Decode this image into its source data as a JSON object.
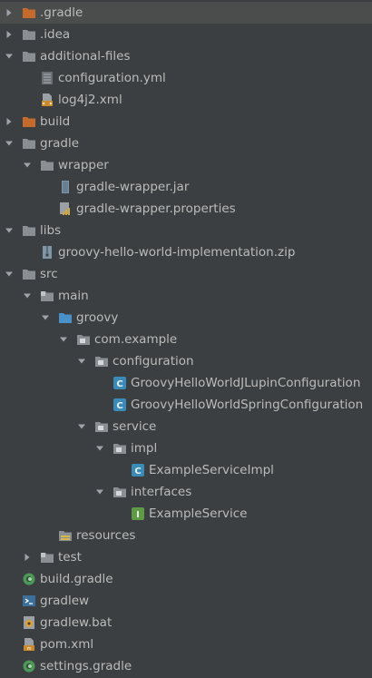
{
  "tree": {
    "items": [
      {
        "label": ".gradle",
        "icon": "folder-excluded-icon",
        "state": "collapsed",
        "selected": true
      },
      {
        "label": ".idea",
        "icon": "folder-icon",
        "state": "collapsed"
      },
      {
        "label": "additional-files",
        "icon": "folder-icon",
        "state": "expanded"
      },
      {
        "label": "configuration.yml",
        "icon": "yaml-file-icon",
        "state": "leaf"
      },
      {
        "label": "log4j2.xml",
        "icon": "xml-file-icon",
        "state": "leaf"
      },
      {
        "label": "build",
        "icon": "folder-excluded-icon",
        "state": "collapsed"
      },
      {
        "label": "gradle",
        "icon": "folder-icon",
        "state": "expanded"
      },
      {
        "label": "wrapper",
        "icon": "folder-icon",
        "state": "expanded"
      },
      {
        "label": "gradle-wrapper.jar",
        "icon": "jar-file-icon",
        "state": "leaf"
      },
      {
        "label": "gradle-wrapper.properties",
        "icon": "properties-file-icon",
        "state": "leaf"
      },
      {
        "label": "libs",
        "icon": "folder-icon",
        "state": "expanded"
      },
      {
        "label": "groovy-hello-world-implementation.zip",
        "icon": "archive-file-icon",
        "state": "leaf"
      },
      {
        "label": "src",
        "icon": "folder-icon",
        "state": "expanded"
      },
      {
        "label": "main",
        "icon": "module-folder-icon",
        "state": "expanded"
      },
      {
        "label": "groovy",
        "icon": "source-root-folder-icon",
        "state": "expanded"
      },
      {
        "label": "com.example",
        "icon": "package-icon",
        "state": "expanded"
      },
      {
        "label": "configuration",
        "icon": "package-icon",
        "state": "expanded"
      },
      {
        "label": "GroovyHelloWorldJLupinConfiguration",
        "icon": "groovy-class-icon",
        "state": "leaf"
      },
      {
        "label": "GroovyHelloWorldSpringConfiguration",
        "icon": "groovy-class-icon",
        "state": "leaf"
      },
      {
        "label": "service",
        "icon": "package-icon",
        "state": "expanded"
      },
      {
        "label": "impl",
        "icon": "package-icon",
        "state": "expanded"
      },
      {
        "label": "ExampleServiceImpl",
        "icon": "groovy-class-icon",
        "state": "leaf"
      },
      {
        "label": "interfaces",
        "icon": "package-icon",
        "state": "expanded"
      },
      {
        "label": "ExampleService",
        "icon": "groovy-interface-icon",
        "state": "leaf"
      },
      {
        "label": "resources",
        "icon": "resources-folder-icon",
        "state": "leaf"
      },
      {
        "label": "test",
        "icon": "module-folder-icon",
        "state": "collapsed"
      },
      {
        "label": "build.gradle",
        "icon": "gradle-file-icon",
        "state": "leaf"
      },
      {
        "label": "gradlew",
        "icon": "shell-script-icon",
        "state": "leaf"
      },
      {
        "label": "gradlew.bat",
        "icon": "batch-file-icon",
        "state": "leaf"
      },
      {
        "label": "pom.xml",
        "icon": "maven-file-icon",
        "state": "leaf"
      },
      {
        "label": "settings.gradle",
        "icon": "gradle-file-icon",
        "state": "leaf"
      }
    ]
  },
  "colors": {
    "background": "#3c3f41",
    "selection": "#4b4d4d",
    "text": "#bbbbbb",
    "folder": "#8a8f94",
    "excluded_folder": "#c46a2c",
    "source_root": "#4a90c9",
    "groovy_class": "#3b8bb8",
    "groovy_interface": "#5f9a46"
  }
}
